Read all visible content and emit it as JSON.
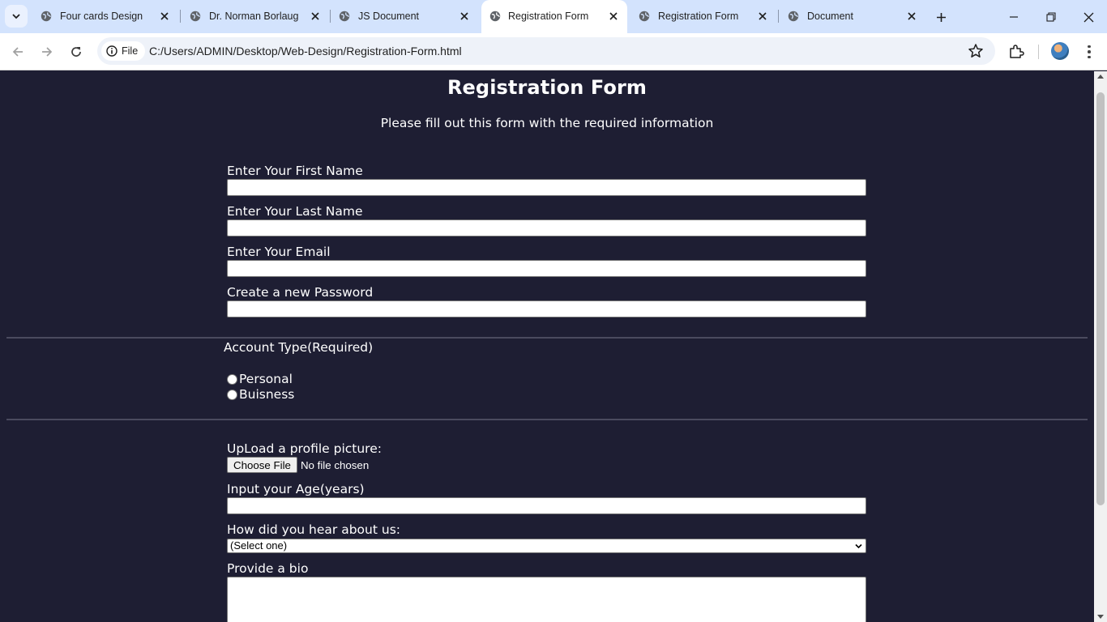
{
  "browser": {
    "tabs": [
      {
        "title": "Four cards Design",
        "active": false
      },
      {
        "title": "Dr. Norman Borlaug",
        "active": false
      },
      {
        "title": "JS Document",
        "active": false
      },
      {
        "title": "Registration Form",
        "active": true
      },
      {
        "title": "Registration Form",
        "active": false
      },
      {
        "title": "Document",
        "active": false
      }
    ],
    "chip_label": "File",
    "url": "C:/Users/ADMIN/Desktop/Web-Design/Registration-Form.html"
  },
  "page": {
    "title": "Registration Form",
    "subtitle": "Please fill out this form with the required information",
    "fields": {
      "first_name_label": "Enter Your First Name",
      "last_name_label": "Enter Your Last Name",
      "email_label": "Enter Your Email",
      "password_label": "Create a new Password"
    },
    "account_type": {
      "legend": "Account Type(Required)",
      "options": [
        "Personal",
        "Buisness"
      ]
    },
    "upload": {
      "label": "UpLoad a profile picture:",
      "button": "Choose File",
      "status": "No file chosen"
    },
    "age_label": "Input your Age(years)",
    "referrer": {
      "label": "How did you hear about us:",
      "selected": "(Select one)"
    },
    "bio_label": "Provide a bio"
  },
  "colors": {
    "page_background": "#1e1e33",
    "tabbar": "#d3e3fd",
    "text": "#ffffff"
  }
}
